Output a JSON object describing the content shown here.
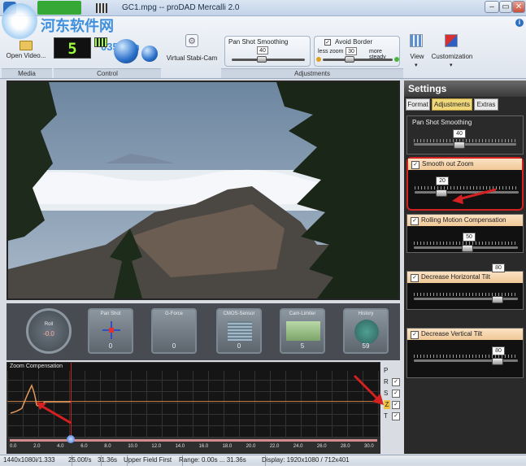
{
  "window": {
    "title": "GC1.mpg -- proDAD Mercalli 2.0",
    "minimize": "–",
    "maximize": "▭",
    "close": "✕",
    "help": "i"
  },
  "watermark": {
    "text": "河东软件网",
    "url": "0359.cn"
  },
  "ribbon": {
    "open_video": "Open Video...",
    "media_label": "Media",
    "control_label": "Control",
    "lcd_value": "5",
    "virtual_stabi_cam": "Virtual Stabi-Cam",
    "pan_shot_smoothing": "Pan Shot Smoothing",
    "pan_shot_value": "40",
    "avoid_border": "Avoid Border",
    "less_zoom": "less zoom",
    "more_steady": "more steady",
    "avoid_border_value": "30",
    "adjustments_label": "Adjustments",
    "view": "View",
    "customization": "Customization"
  },
  "gauges": [
    {
      "label": "Roll",
      "value": "-0.0"
    },
    {
      "label": "Pan Shot",
      "value": "0"
    },
    {
      "label": "G-Force",
      "value": "0"
    },
    {
      "label": "CMOS-Sensor",
      "value": "0"
    },
    {
      "label": "Cam-Limiter",
      "value": "5"
    },
    {
      "label": "History",
      "value": "59"
    }
  ],
  "graph": {
    "title": "Zoom Compensation",
    "ruler_ticks": [
      "0.0",
      "2.0",
      "4.0",
      "6.0",
      "8.0",
      "10.0",
      "12.0",
      "14.0",
      "16.0",
      "18.0",
      "20.0",
      "22.0",
      "24.0",
      "26.0",
      "28.0",
      "30.0"
    ],
    "channels": [
      {
        "letter": "P",
        "checked": false
      },
      {
        "letter": "R",
        "checked": true
      },
      {
        "letter": "S",
        "checked": true
      },
      {
        "letter": "Z",
        "checked": true
      },
      {
        "letter": "T",
        "checked": true
      }
    ]
  },
  "settings": {
    "header": "Settings",
    "tabs": [
      "Format",
      "Adjustments",
      "Extras"
    ],
    "active_tab": "Adjustments",
    "pan_shot_smoothing_title": "Pan Shot Smoothing",
    "pan_shot_smoothing_value": "40",
    "smooth_out_zoom": {
      "title": "Smooth out Zoom",
      "value": "20"
    },
    "rolling_motion": {
      "title": "Rolling Motion Compensation",
      "value": "50"
    },
    "decrease_horizontal_tilt": {
      "title": "Decrease Horizontal Tilt",
      "value": "80"
    },
    "decrease_vertical_tilt": {
      "title": "Decrease Vertical Tilt",
      "value": "80"
    }
  },
  "statusbar": {
    "format": "1440x1080i/1.333",
    "fps": "25.00f/s",
    "duration": "31.36s",
    "field": "Upper Field First",
    "range": "Range:  0.00s ... 31.36s",
    "display": "Display:   1920x1080 / 712x401"
  },
  "colors": {
    "accent_orange": "#f0c896",
    "highlight_red": "#d42020",
    "lcd_green": "#9dfc3a"
  }
}
